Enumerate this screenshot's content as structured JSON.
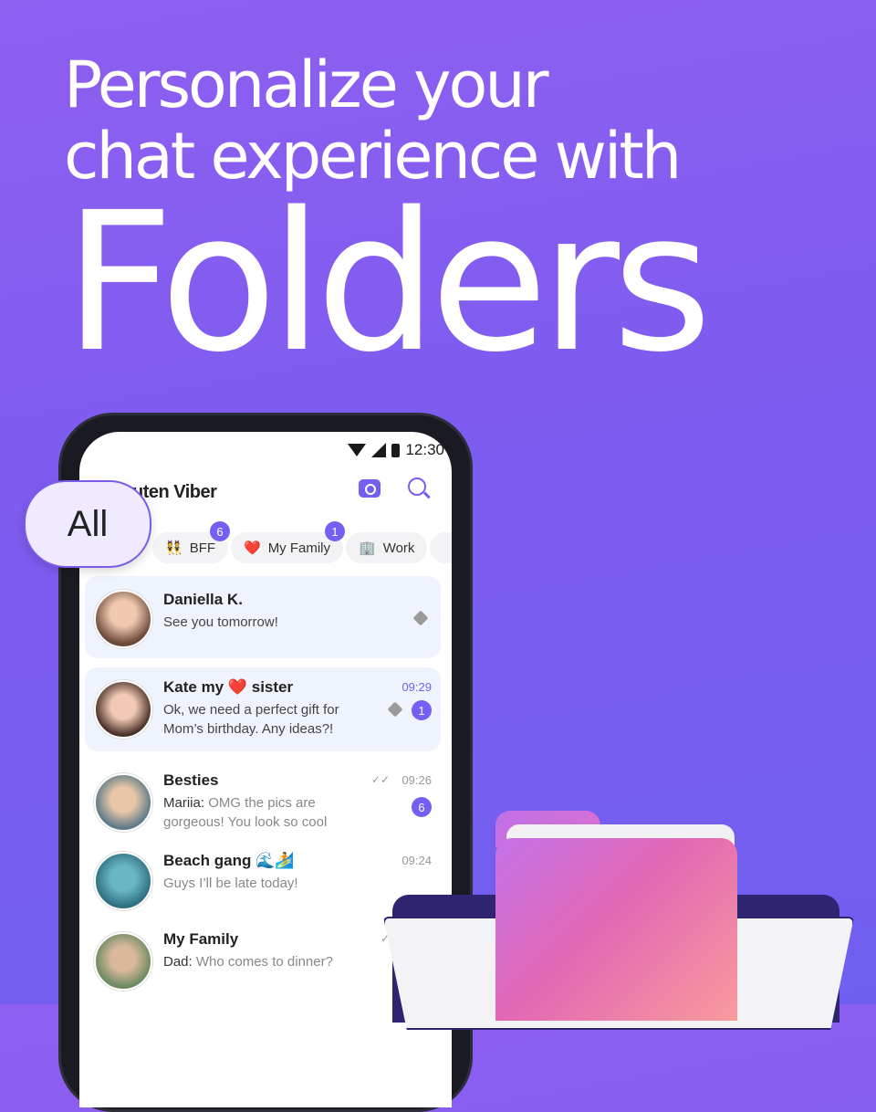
{
  "headline": {
    "line1": "Personalize your",
    "line2": "chat experience with",
    "line3": "Folders"
  },
  "status_bar": {
    "time": "12:30"
  },
  "app": {
    "name": "Rakuten Viber",
    "name_visible": "uten Viber"
  },
  "folders": {
    "active": "All",
    "chips": [
      {
        "emoji": "👯",
        "label": "BFF",
        "badge": "6"
      },
      {
        "emoji": "❤️",
        "label": "My Family",
        "badge": "1"
      },
      {
        "emoji": "🏢",
        "label": "Work",
        "badge": ""
      }
    ]
  },
  "chats": [
    {
      "name": "Daniella K.",
      "message": "See you tomorrow!",
      "time": "",
      "pinned": true
    },
    {
      "name": "Kate my ❤️ sister",
      "message": "Ok, we need a perfect gift for Mom’s birthday. Any ideas?!",
      "time": "09:29",
      "pinned": true,
      "badge": "1"
    },
    {
      "name": "Besties",
      "sender": "Mariia:",
      "message": "OMG the pics are gorgeous! You look so cool",
      "time": "09:26",
      "badge": "6"
    },
    {
      "name": "Beach gang 🌊🏄",
      "message": "Guys I’ll be late today!",
      "time": "09:24"
    },
    {
      "name": "My Family",
      "sender": "Dad:",
      "message": "Who comes to dinner?"
    }
  ],
  "colors": {
    "accent": "#7360f2",
    "background": "#7d5cf0"
  }
}
